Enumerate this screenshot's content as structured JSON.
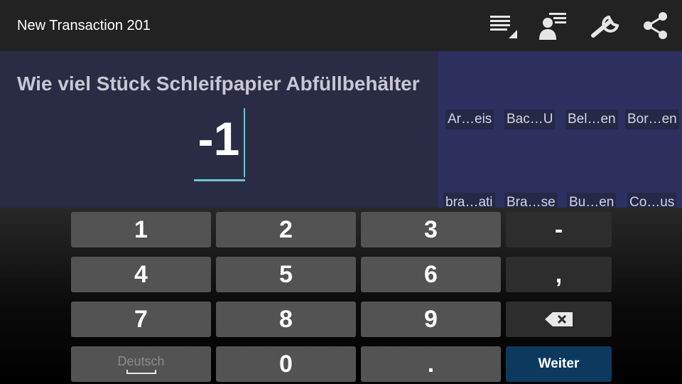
{
  "actionbar": {
    "title": "New Transaction 201",
    "icons": [
      "list-overview-icon",
      "contact-list-icon",
      "wrench-icon",
      "share-icon"
    ]
  },
  "question": {
    "label": "Wie viel Stück Schleifpapier Abfüllbehälter",
    "value": "-1"
  },
  "suggestions": [
    "Ar…eis",
    "Bac…U",
    "Bel…en",
    "Bor…en",
    "bra…ati",
    "Bra…se",
    "Bu…en",
    "Co…us"
  ],
  "keyboard": {
    "rows": [
      [
        "1",
        "2",
        "3",
        "-"
      ],
      [
        "4",
        "5",
        "6",
        ","
      ],
      [
        "7",
        "8",
        "9",
        "⌫"
      ],
      [
        "Deutsch",
        "0",
        ".",
        "Weiter"
      ]
    ],
    "language": "Deutsch",
    "action_label": "Weiter"
  },
  "colors": {
    "actionbar": "#222222",
    "question_panel": "#2a2c45",
    "suggestion_panel": "#2e3060",
    "accent": "#6fc3cf",
    "key": "#535353",
    "key_dark": "#2d2d2d",
    "key_primary": "#0c3a5f"
  }
}
